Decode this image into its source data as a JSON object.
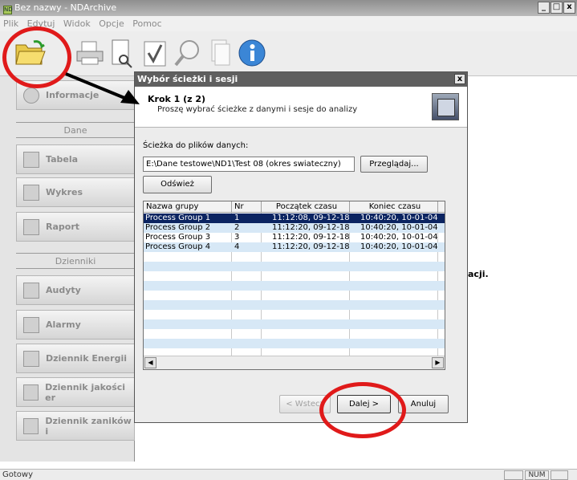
{
  "window": {
    "title": "Bez nazwy - NDArchive",
    "app_icon_text": "ND",
    "minimize": "_",
    "maximize": "□",
    "close": "x"
  },
  "menu": [
    "Plik",
    "Edytuj",
    "Widok",
    "Opcje",
    "Pomoc"
  ],
  "toolbar": [
    "open-icon",
    "print-icon",
    "print-preview-icon",
    "check-icon",
    "search-icon",
    "document-icon",
    "info-icon"
  ],
  "sidebar": {
    "info_label": "Informacje",
    "section_data": "Dane",
    "table": "Tabela",
    "chart": "Wykres",
    "report": "Raport",
    "section_logs": "Dzienniki",
    "audits": "Audyty",
    "alarms": "Alarmy",
    "energy_log": "Dziennik Energii",
    "quality_log": "Dziennik jakości er",
    "outage_log": "Dziennik zaników i"
  },
  "main": {
    "partial_text": "acji."
  },
  "status": {
    "text": "Gotowy",
    "num": "NUM"
  },
  "dialog": {
    "title": "Wybór ścieżki i sesji",
    "close": "x",
    "step_title": "Krok 1 (z 2)",
    "step_desc": "Proszę wybrać ścieżke z danymi i sesje do analizy",
    "path_label": "Ścieżka do plików danych:",
    "path_value": "E:\\Dane testowe\\ND1\\Test 08 (okres swiateczny)",
    "browse": "Przeglądaj...",
    "refresh": "Odśwież",
    "columns": [
      "Nazwa grupy",
      "Nr",
      "Początek czasu",
      "Koniec czasu"
    ],
    "rows": [
      [
        "Process Group 1",
        "1",
        "11:12:08, 09-12-18",
        "10:40:20, 10-01-04"
      ],
      [
        "Process Group 2",
        "2",
        "11:12:20, 09-12-18",
        "10:40:20, 10-01-04"
      ],
      [
        "Process Group 3",
        "3",
        "11:12:20, 09-12-18",
        "10:40:20, 10-01-04"
      ],
      [
        "Process Group 4",
        "4",
        "11:12:20, 09-12-18",
        "10:40:20, 10-01-04"
      ]
    ],
    "back": "< Wstecz",
    "next": "Dalej >",
    "cancel": "Anuluj",
    "scroll_left": "◀",
    "scroll_right": "▶"
  },
  "annotation_color": "#e01a1a"
}
